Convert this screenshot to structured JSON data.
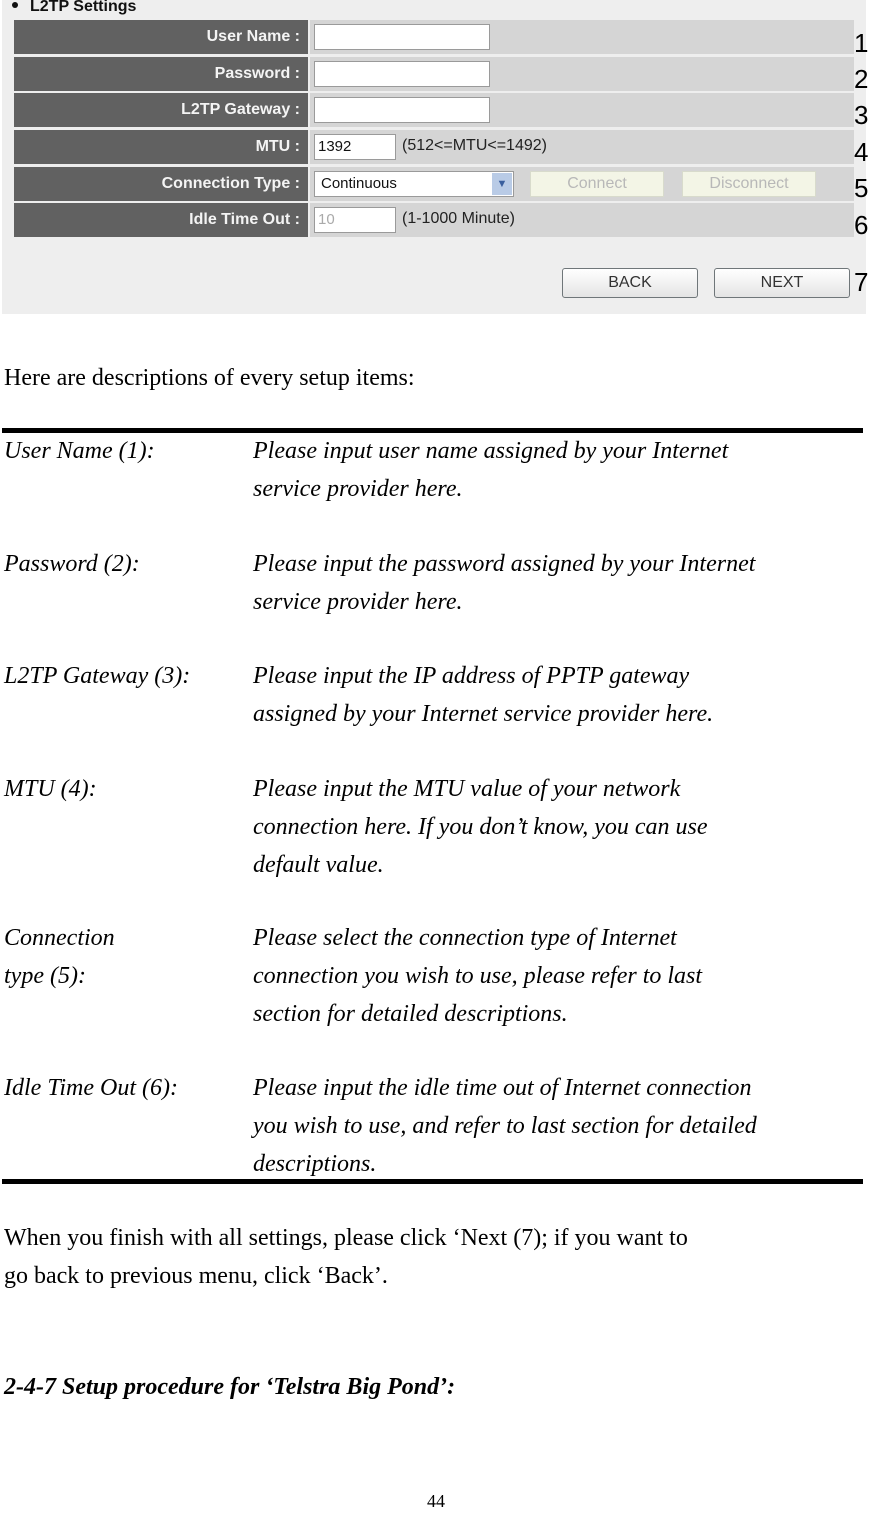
{
  "panel": {
    "title": "L2TP Settings",
    "fields": {
      "user_name": {
        "label": "User Name :",
        "value": ""
      },
      "password": {
        "label": "Password :",
        "value": ""
      },
      "gateway": {
        "label": "L2TP Gateway :",
        "value": ""
      },
      "mtu": {
        "label": "MTU :",
        "value": "1392",
        "hint": "(512<=MTU<=1492)"
      },
      "connection_type": {
        "label": "Connection Type :",
        "selected": "Continuous",
        "connect_label": "Connect",
        "disconnect_label": "Disconnect"
      },
      "idle_timeout": {
        "label": "Idle Time Out :",
        "value": "10",
        "hint": "(1-1000 Minute)"
      }
    },
    "back_label": "BACK",
    "next_label": "NEXT",
    "markers": [
      "1",
      "2",
      "3",
      "4",
      "5",
      "6",
      "7"
    ]
  },
  "intro": "Here are descriptions of every setup items:",
  "descriptions": [
    {
      "term": "User Name (1):",
      "lines": [
        "Please input user name assigned by your Internet",
        "service provider here."
      ]
    },
    {
      "term": "Password (2):",
      "lines": [
        "Please input the password assigned by your Internet",
        "service provider here."
      ]
    },
    {
      "term": "L2TP Gateway (3):",
      "lines": [
        "Please input the IP address of PPTP gateway",
        "assigned by your Internet service provider here."
      ]
    },
    {
      "term": "MTU (4):",
      "lines": [
        "Please input the MTU value of your network",
        "connection here. If you don’t know, you can use",
        "default value."
      ]
    },
    {
      "term_lines": [
        "Connection",
        "type (5):"
      ],
      "lines": [
        "Please select the connection type of Internet",
        "connection you wish to use, please refer to last",
        "section for detailed descriptions."
      ]
    },
    {
      "term": "Idle Time Out (6):",
      "lines": [
        "Please input the idle time out of Internet connection",
        "you wish to use, and refer to last section for detailed",
        "descriptions."
      ]
    }
  ],
  "closing": [
    "When you finish with all settings, please click ‘Next (7); if you want to",
    "go back to previous menu, click ‘Back’."
  ],
  "section_heading": "2-4-7 Setup procedure for ‘Telstra Big Pond’:",
  "page_number": "44"
}
